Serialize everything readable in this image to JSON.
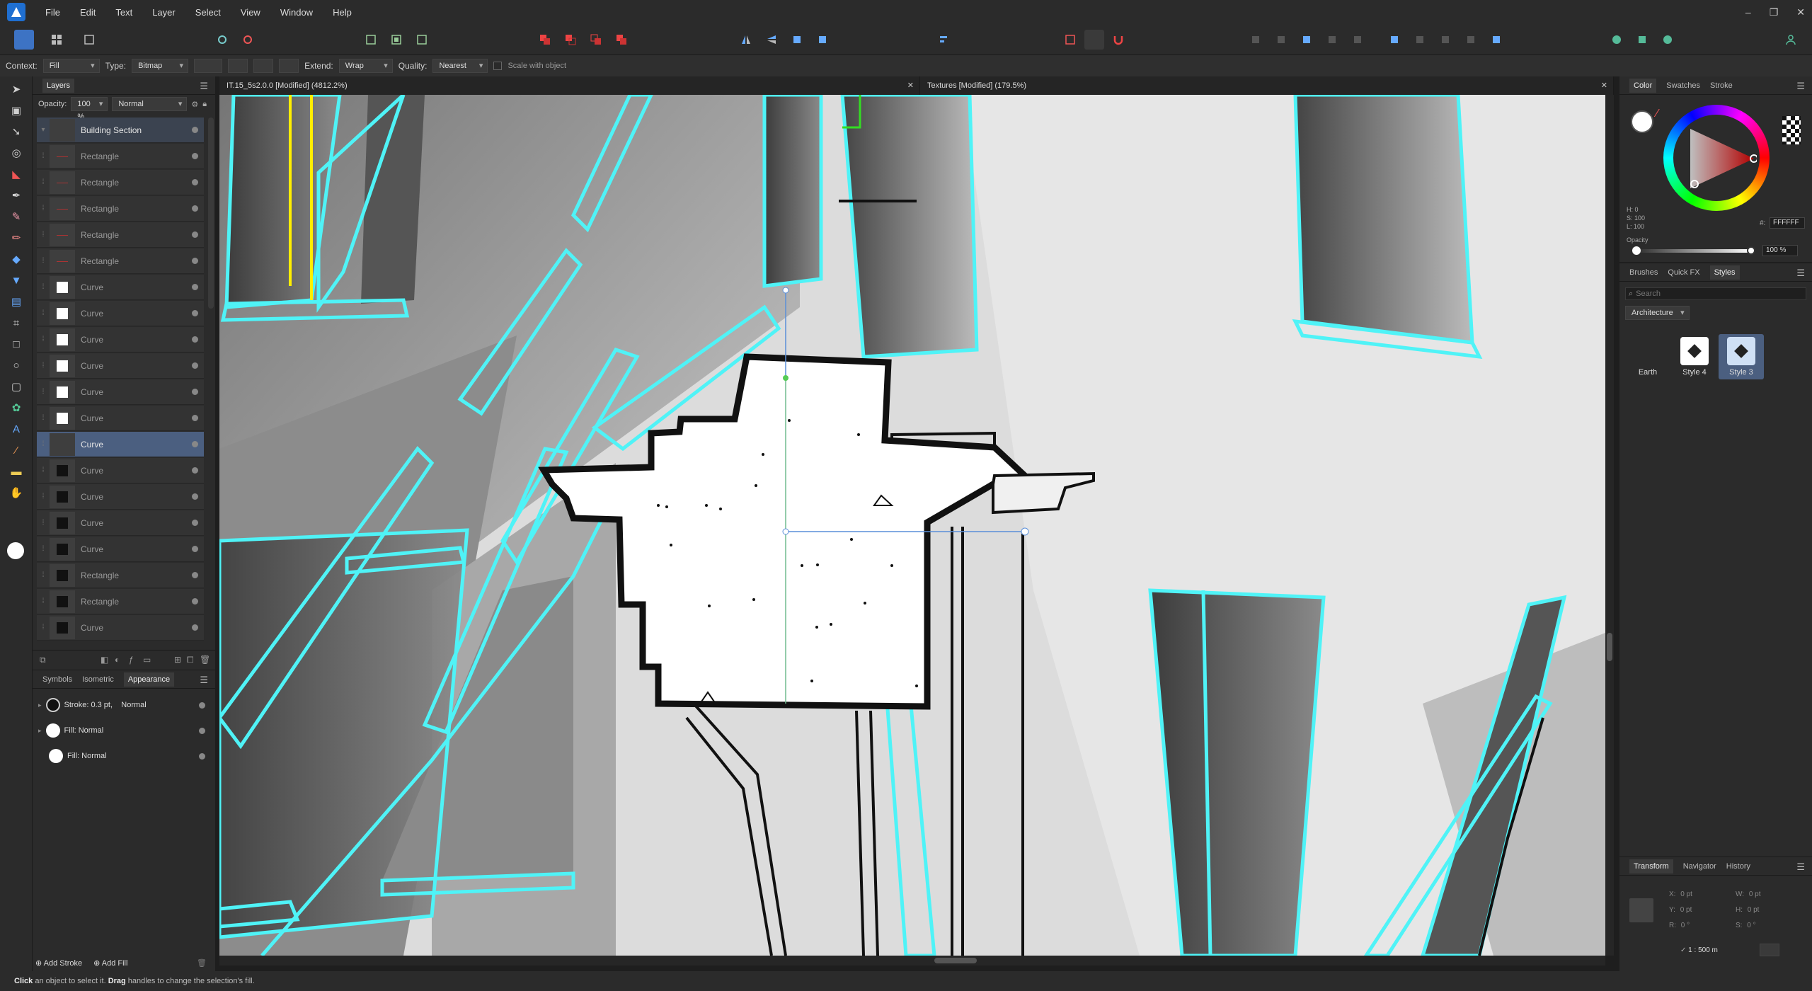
{
  "menubar": {
    "items": [
      "File",
      "Edit",
      "Text",
      "Layer",
      "Select",
      "View",
      "Window",
      "Help"
    ]
  },
  "context_toolbar": {
    "context_label": "Context:",
    "context_value": "Fill",
    "type_label": "Type:",
    "type_value": "Bitmap",
    "extend_label": "Extend:",
    "extend_value": "Wrap",
    "quality_label": "Quality:",
    "quality_value": "Nearest",
    "scale_with_object": "Scale with object"
  },
  "layers_panel": {
    "tab": "Layers",
    "opacity_label": "Opacity:",
    "opacity_value": "100 %",
    "blend_mode": "Normal",
    "rows": [
      {
        "name": "Building Section"
      },
      {
        "name": "Rectangle"
      },
      {
        "name": "Rectangle"
      },
      {
        "name": "Rectangle"
      },
      {
        "name": "Rectangle"
      },
      {
        "name": "Rectangle"
      },
      {
        "name": "Curve"
      },
      {
        "name": "Curve"
      },
      {
        "name": "Curve"
      },
      {
        "name": "Curve"
      },
      {
        "name": "Curve"
      },
      {
        "name": "Curve"
      },
      {
        "name": "Curve"
      },
      {
        "name": "Curve"
      },
      {
        "name": "Curve"
      },
      {
        "name": "Curve"
      },
      {
        "name": "Curve"
      },
      {
        "name": "Rectangle"
      },
      {
        "name": "Rectangle"
      },
      {
        "name": "Curve"
      }
    ]
  },
  "appearance_panel": {
    "tabs": [
      "Symbols",
      "Isometric",
      "Appearance"
    ],
    "rows": [
      {
        "label": "Stroke:",
        "detail": "0.3 pt,",
        "mode": "Normal"
      },
      {
        "label": "Fill:",
        "detail": "",
        "mode": "Normal"
      },
      {
        "label": "Fill:",
        "detail": "",
        "mode": "Normal"
      }
    ],
    "add_stroke": "Add Stroke",
    "add_fill": "Add Fill"
  },
  "documents": {
    "tab1": "IT.15_5s2.0.0 [Modified] (4812.2%)",
    "tab2": "Textures [Modified] (179.5%)"
  },
  "color_panel": {
    "tabs": [
      "Color",
      "Swatches",
      "Stroke"
    ],
    "hsl": {
      "h": "H: 0",
      "s": "S: 100",
      "l": "L: 100"
    },
    "hex_label": "#:",
    "hex_value": "FFFFFF",
    "opacity_label": "Opacity",
    "opacity_value": "100 %",
    "accent_cyan": "#4ff3f7"
  },
  "styles_panel": {
    "tabs": [
      "Brushes",
      "Quick FX",
      "Styles"
    ],
    "search_placeholder": "Search",
    "category": "Architecture",
    "items": [
      "Earth",
      "Style 4",
      "Style 3"
    ]
  },
  "transform_panel": {
    "tabs": [
      "Transform",
      "Navigator",
      "History"
    ],
    "x": "X:",
    "x_val": "0 pt",
    "y": "Y:",
    "y_val": "0 pt",
    "w": "W:",
    "w_val": "0 pt",
    "h": "H:",
    "h_val": "0 pt",
    "r": "R:",
    "r_val": "0 °",
    "s": "S:",
    "s_val": "0 °",
    "scale": "1 : 500 m"
  },
  "status": {
    "click": "Click",
    "text1": " an object to select it. ",
    "drag": "Drag",
    "text2": " handles to change the selection's fill."
  }
}
